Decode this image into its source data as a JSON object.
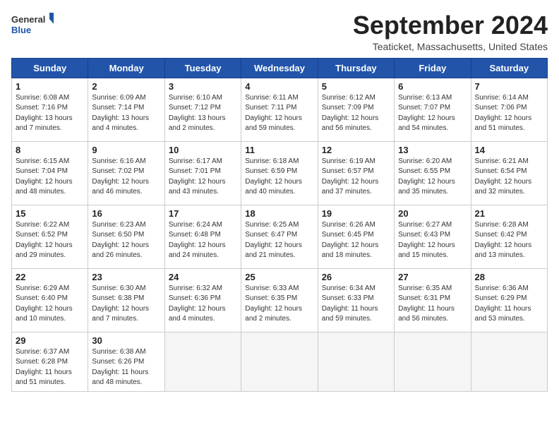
{
  "header": {
    "logo_line1": "General",
    "logo_line2": "Blue",
    "month_title": "September 2024",
    "subtitle": "Teaticket, Massachusetts, United States"
  },
  "weekdays": [
    "Sunday",
    "Monday",
    "Tuesday",
    "Wednesday",
    "Thursday",
    "Friday",
    "Saturday"
  ],
  "weeks": [
    [
      {
        "day": "1",
        "info": "Sunrise: 6:08 AM\nSunset: 7:16 PM\nDaylight: 13 hours\nand 7 minutes."
      },
      {
        "day": "2",
        "info": "Sunrise: 6:09 AM\nSunset: 7:14 PM\nDaylight: 13 hours\nand 4 minutes."
      },
      {
        "day": "3",
        "info": "Sunrise: 6:10 AM\nSunset: 7:12 PM\nDaylight: 13 hours\nand 2 minutes."
      },
      {
        "day": "4",
        "info": "Sunrise: 6:11 AM\nSunset: 7:11 PM\nDaylight: 12 hours\nand 59 minutes."
      },
      {
        "day": "5",
        "info": "Sunrise: 6:12 AM\nSunset: 7:09 PM\nDaylight: 12 hours\nand 56 minutes."
      },
      {
        "day": "6",
        "info": "Sunrise: 6:13 AM\nSunset: 7:07 PM\nDaylight: 12 hours\nand 54 minutes."
      },
      {
        "day": "7",
        "info": "Sunrise: 6:14 AM\nSunset: 7:06 PM\nDaylight: 12 hours\nand 51 minutes."
      }
    ],
    [
      {
        "day": "8",
        "info": "Sunrise: 6:15 AM\nSunset: 7:04 PM\nDaylight: 12 hours\nand 48 minutes."
      },
      {
        "day": "9",
        "info": "Sunrise: 6:16 AM\nSunset: 7:02 PM\nDaylight: 12 hours\nand 46 minutes."
      },
      {
        "day": "10",
        "info": "Sunrise: 6:17 AM\nSunset: 7:01 PM\nDaylight: 12 hours\nand 43 minutes."
      },
      {
        "day": "11",
        "info": "Sunrise: 6:18 AM\nSunset: 6:59 PM\nDaylight: 12 hours\nand 40 minutes."
      },
      {
        "day": "12",
        "info": "Sunrise: 6:19 AM\nSunset: 6:57 PM\nDaylight: 12 hours\nand 37 minutes."
      },
      {
        "day": "13",
        "info": "Sunrise: 6:20 AM\nSunset: 6:55 PM\nDaylight: 12 hours\nand 35 minutes."
      },
      {
        "day": "14",
        "info": "Sunrise: 6:21 AM\nSunset: 6:54 PM\nDaylight: 12 hours\nand 32 minutes."
      }
    ],
    [
      {
        "day": "15",
        "info": "Sunrise: 6:22 AM\nSunset: 6:52 PM\nDaylight: 12 hours\nand 29 minutes."
      },
      {
        "day": "16",
        "info": "Sunrise: 6:23 AM\nSunset: 6:50 PM\nDaylight: 12 hours\nand 26 minutes."
      },
      {
        "day": "17",
        "info": "Sunrise: 6:24 AM\nSunset: 6:48 PM\nDaylight: 12 hours\nand 24 minutes."
      },
      {
        "day": "18",
        "info": "Sunrise: 6:25 AM\nSunset: 6:47 PM\nDaylight: 12 hours\nand 21 minutes."
      },
      {
        "day": "19",
        "info": "Sunrise: 6:26 AM\nSunset: 6:45 PM\nDaylight: 12 hours\nand 18 minutes."
      },
      {
        "day": "20",
        "info": "Sunrise: 6:27 AM\nSunset: 6:43 PM\nDaylight: 12 hours\nand 15 minutes."
      },
      {
        "day": "21",
        "info": "Sunrise: 6:28 AM\nSunset: 6:42 PM\nDaylight: 12 hours\nand 13 minutes."
      }
    ],
    [
      {
        "day": "22",
        "info": "Sunrise: 6:29 AM\nSunset: 6:40 PM\nDaylight: 12 hours\nand 10 minutes."
      },
      {
        "day": "23",
        "info": "Sunrise: 6:30 AM\nSunset: 6:38 PM\nDaylight: 12 hours\nand 7 minutes."
      },
      {
        "day": "24",
        "info": "Sunrise: 6:32 AM\nSunset: 6:36 PM\nDaylight: 12 hours\nand 4 minutes."
      },
      {
        "day": "25",
        "info": "Sunrise: 6:33 AM\nSunset: 6:35 PM\nDaylight: 12 hours\nand 2 minutes."
      },
      {
        "day": "26",
        "info": "Sunrise: 6:34 AM\nSunset: 6:33 PM\nDaylight: 11 hours\nand 59 minutes."
      },
      {
        "day": "27",
        "info": "Sunrise: 6:35 AM\nSunset: 6:31 PM\nDaylight: 11 hours\nand 56 minutes."
      },
      {
        "day": "28",
        "info": "Sunrise: 6:36 AM\nSunset: 6:29 PM\nDaylight: 11 hours\nand 53 minutes."
      }
    ],
    [
      {
        "day": "29",
        "info": "Sunrise: 6:37 AM\nSunset: 6:28 PM\nDaylight: 11 hours\nand 51 minutes."
      },
      {
        "day": "30",
        "info": "Sunrise: 6:38 AM\nSunset: 6:26 PM\nDaylight: 11 hours\nand 48 minutes."
      },
      {
        "day": "",
        "info": ""
      },
      {
        "day": "",
        "info": ""
      },
      {
        "day": "",
        "info": ""
      },
      {
        "day": "",
        "info": ""
      },
      {
        "day": "",
        "info": ""
      }
    ]
  ]
}
